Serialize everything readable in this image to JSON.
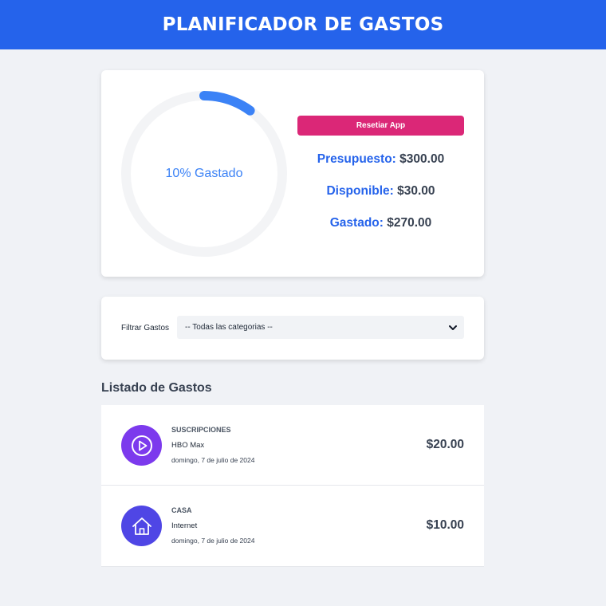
{
  "header": {
    "title": "PLANIFICADOR DE GASTOS"
  },
  "budget": {
    "progress_label": "10% Gastado",
    "progress_percent": 10,
    "reset_label": "Resetiar App",
    "presupuesto_label": "Presupuesto:",
    "presupuesto_value": "$300.00",
    "disponible_label": "Disponible:",
    "disponible_value": "$30.00",
    "gastado_label": "Gastado:",
    "gastado_value": "$270.00"
  },
  "filter": {
    "label": "Filtrar Gastos",
    "selected": "-- Todas las categorias --"
  },
  "list": {
    "title": "Listado de Gastos",
    "items": [
      {
        "category": "SUSCRIPCIONES",
        "name": "HBO Max",
        "date": "domingo, 7 de julio de 2024",
        "amount": "$20.00",
        "icon": "play-icon",
        "icon_color": "#7c3aed"
      },
      {
        "category": "CASA",
        "name": "Internet",
        "date": "domingo, 7 de julio de 2024",
        "amount": "$10.00",
        "icon": "house-icon",
        "icon_color": "#4f46e5"
      }
    ]
  },
  "colors": {
    "header": "#2563eb",
    "accent": "#3b82f6",
    "reset_button": "#db2777",
    "progress_track": "#f3f4f6"
  }
}
